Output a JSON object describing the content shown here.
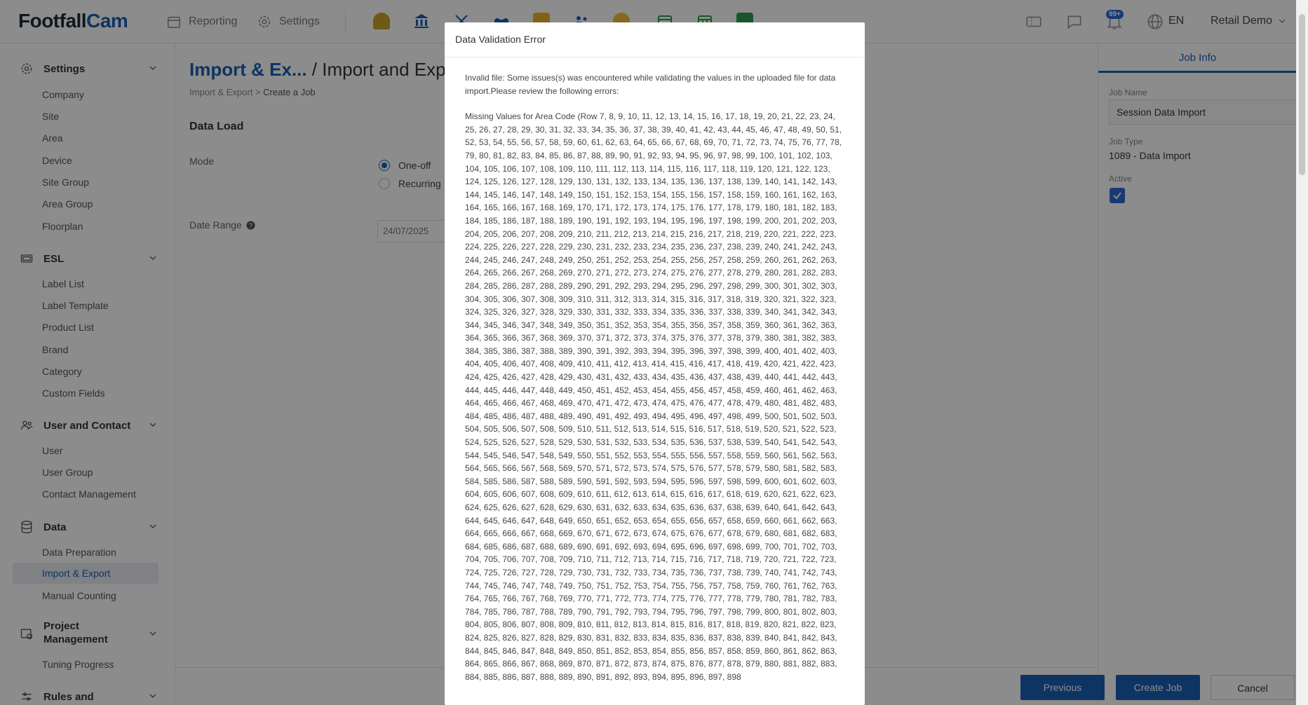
{
  "header": {
    "logo_part1": "Footfall",
    "logo_part2": "Cam",
    "nav": [
      {
        "label": "Reporting",
        "icon": "calendar-icon"
      },
      {
        "label": "Settings",
        "icon": "gear-icon"
      }
    ],
    "notification_badge": "99+",
    "language": "EN",
    "user": "Retail Demo"
  },
  "sidebar": {
    "sections": [
      {
        "label": "Settings",
        "items": [
          "Company",
          "Site",
          "Area",
          "Device",
          "Site Group",
          "Area Group",
          "Floorplan"
        ]
      },
      {
        "label": "ESL",
        "items": [
          "Label List",
          "Label Template",
          "Product List",
          "Brand",
          "Category",
          "Custom Fields"
        ]
      },
      {
        "label": "User and Contact",
        "items": [
          "User",
          "User Group",
          "Contact Management"
        ]
      },
      {
        "label": "Data",
        "items": [
          "Data Preparation",
          "Import & Export",
          "Manual Counting"
        ]
      },
      {
        "label": "Project Management",
        "items": [
          "Tuning Progress"
        ]
      },
      {
        "label": "Rules and",
        "items": []
      }
    ],
    "active_item": "Import & Export"
  },
  "main": {
    "title_link": "Import & Ex...",
    "title_sep": " / ",
    "title_rest": "Import and Expor",
    "breadcrumb_1": "Import & Export",
    "breadcrumb_sep": ">",
    "breadcrumb_2": "Create a Job",
    "section": "Data Load",
    "mode_label": "Mode",
    "mode_options": [
      "One-off",
      "Recurring"
    ],
    "date_range_label": "Date Range",
    "date_value": "24/07/2025"
  },
  "right_panel": {
    "tab": "Job Info",
    "job_name_label": "Job Name",
    "job_name_value": "Session Data Import",
    "job_type_label": "Job Type",
    "job_type_value": "1089 - Data Import",
    "active_label": "Active"
  },
  "buttons": {
    "previous": "Previous",
    "create": "Create Job",
    "cancel": "Cancel"
  },
  "modal": {
    "title": "Data Validation Error",
    "intro": "Invalid file: Some issues(s) was encountered while validating the values in the uploaded file for data import.Please review the following errors:",
    "missing_prefix": "Missing Values for Area Code (Row ",
    "missing_rows_start": 7,
    "missing_rows_end": 898
  },
  "colors": {
    "accent": "#1a5fb4",
    "badge": "#2b6bd6"
  }
}
